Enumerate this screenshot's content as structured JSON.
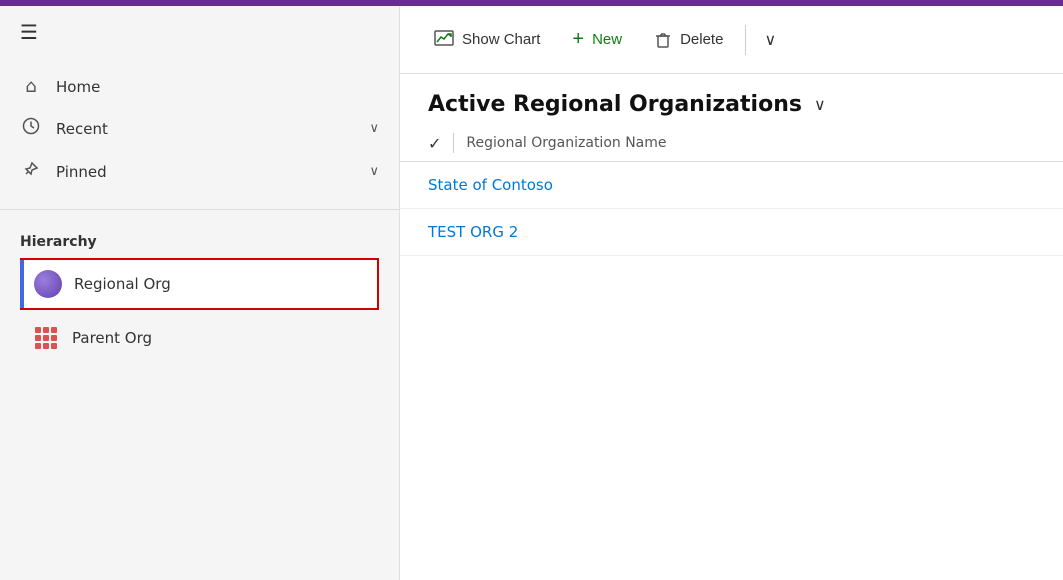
{
  "topBar": {},
  "sidebar": {
    "navItems": [
      {
        "id": "home",
        "label": "Home",
        "icon": "⌂",
        "hasChevron": false
      },
      {
        "id": "recent",
        "label": "Recent",
        "icon": "⏱",
        "hasChevron": true
      },
      {
        "id": "pinned",
        "label": "Pinned",
        "icon": "📌",
        "hasChevron": true
      }
    ],
    "hierarchyLabel": "Hierarchy",
    "hierarchyItems": [
      {
        "id": "regional-org",
        "label": "Regional Org",
        "type": "sphere",
        "selected": true
      },
      {
        "id": "parent-org",
        "label": "Parent Org",
        "type": "grid",
        "selected": false
      }
    ]
  },
  "toolbar": {
    "showChartLabel": "Show Chart",
    "newLabel": "New",
    "deleteLabel": "Delete"
  },
  "main": {
    "title": "Active Regional Organizations",
    "columnHeader": "Regional Organization Name",
    "rows": [
      {
        "id": 1,
        "name": "State of Contoso"
      },
      {
        "id": 2,
        "name": "TEST ORG 2"
      }
    ]
  }
}
